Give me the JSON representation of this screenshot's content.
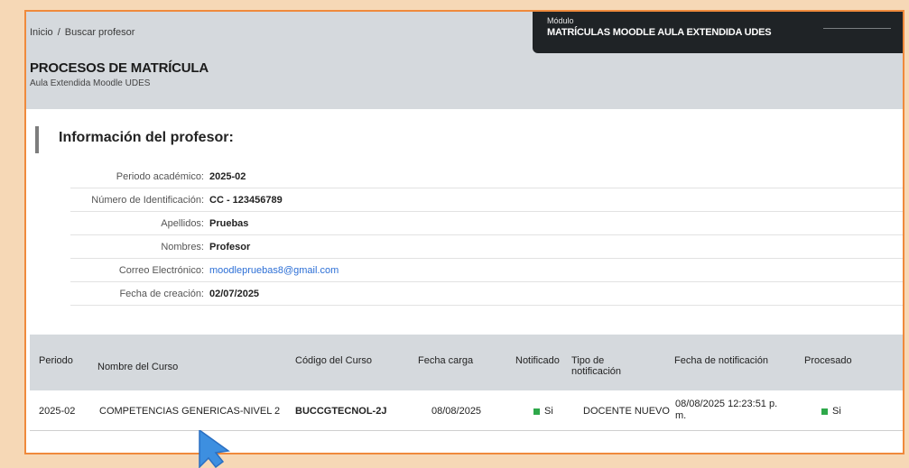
{
  "breadcrumb": {
    "home": "Inicio",
    "separator": "/",
    "current": "Buscar profesor"
  },
  "header": {
    "title": "PROCESOS DE MATRÍCULA",
    "subtitle": "Aula Extendida Moodle UDES"
  },
  "module": {
    "label": "Módulo",
    "name": "MATRÍCULAS MOODLE AULA EXTENDIDA UDES"
  },
  "section": {
    "title": "Información del profesor:"
  },
  "teacher": {
    "period_label": "Periodo académico:",
    "period": "2025-02",
    "id_label": "Número de Identificación:",
    "id": "CC - 123456789",
    "lastname_label": "Apellidos:",
    "lastname": "Pruebas",
    "name_label": "Nombres:",
    "name": "Profesor",
    "email_label": "Correo Electrónico:",
    "email": "moodlepruebas8@gmail.com",
    "created_label": "Fecha de creación:",
    "created": "02/07/2025"
  },
  "table": {
    "headers": {
      "periodo": "Periodo",
      "curso": "Nombre del Curso",
      "codigo": "Código del Curso",
      "fecha_carga": "Fecha carga",
      "notificado": "Notificado",
      "tipo_1": "Tipo de",
      "tipo_2": "notificación",
      "fecha_notif": "Fecha de notificación",
      "procesado": "Procesado"
    },
    "rows": [
      {
        "periodo": "2025-02",
        "curso": "COMPETENCIAS GENERICAS-NIVEL 2",
        "codigo": "BUCCGTECNOL-2J",
        "fecha_carga": "08/08/2025",
        "notificado": "Si",
        "tipo": "DOCENTE NUEVO",
        "fecha_notif_1": "08/08/2025 12:23:51 p.",
        "fecha_notif_2": "m.",
        "procesado": "Si"
      }
    ]
  },
  "colors": {
    "accent": "#ef8a3c",
    "status_ok": "#2ea84a",
    "link": "#2c6fd6",
    "cursor": "#3d8fe0"
  }
}
